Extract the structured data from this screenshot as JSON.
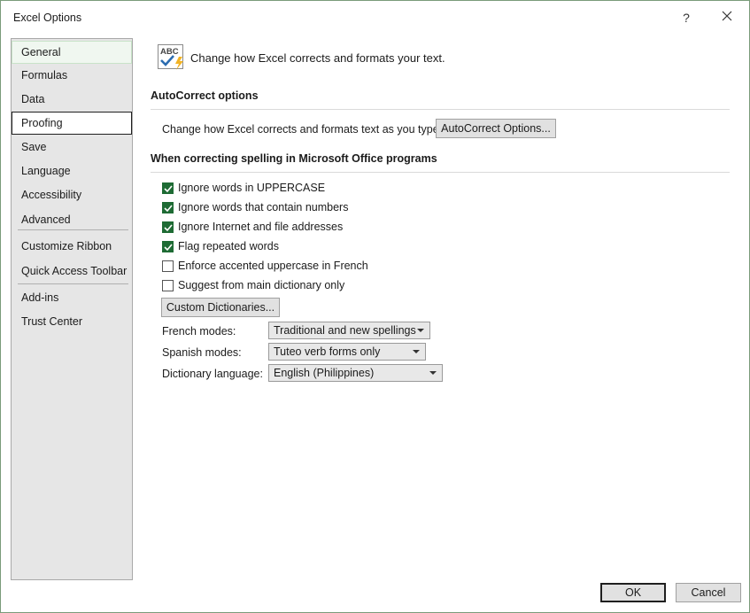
{
  "window": {
    "title": "Excel Options",
    "help_label": "?",
    "close_icon": "close-icon"
  },
  "sidebar": {
    "items": [
      {
        "label": "General"
      },
      {
        "label": "Formulas"
      },
      {
        "label": "Data"
      },
      {
        "label": "Proofing"
      },
      {
        "label": "Save"
      },
      {
        "label": "Language"
      },
      {
        "label": "Accessibility"
      },
      {
        "label": "Advanced"
      },
      {
        "label": "Customize Ribbon"
      },
      {
        "label": "Quick Access Toolbar"
      },
      {
        "label": "Add-ins"
      },
      {
        "label": "Trust Center"
      }
    ],
    "selected": "Proofing",
    "hovered": "General"
  },
  "main": {
    "header": {
      "icon": "abc-check-icon",
      "text": "Change how Excel corrects and formats your text."
    },
    "autocorrect": {
      "title": "AutoCorrect options",
      "description": "Change how Excel corrects and formats text as you type:",
      "button_label": "AutoCorrect Options..."
    },
    "spelling": {
      "title": "When correcting spelling in Microsoft Office programs",
      "options": [
        {
          "label": "Ignore words in UPPERCASE",
          "checked": true
        },
        {
          "label": "Ignore words that contain numbers",
          "checked": true
        },
        {
          "label": "Ignore Internet and file addresses",
          "checked": true
        },
        {
          "label": "Flag repeated words",
          "checked": true
        },
        {
          "label": "Enforce accented uppercase in French",
          "checked": false
        },
        {
          "label": "Suggest from main dictionary only",
          "checked": false
        }
      ],
      "custom_dictionaries_label": "Custom Dictionaries...",
      "french_modes": {
        "label": "French modes:",
        "value": "Traditional and new spellings"
      },
      "spanish_modes": {
        "label": "Spanish modes:",
        "value": "Tuteo verb forms only"
      },
      "dictionary_language": {
        "label": "Dictionary language:",
        "value": "English (Philippines)"
      }
    }
  },
  "footer": {
    "ok_label": "OK",
    "cancel_label": "Cancel"
  },
  "colors": {
    "accent": "#1e6b34",
    "sidebar_bg": "#e6e6e6",
    "button_bg": "#e1e1e1"
  }
}
